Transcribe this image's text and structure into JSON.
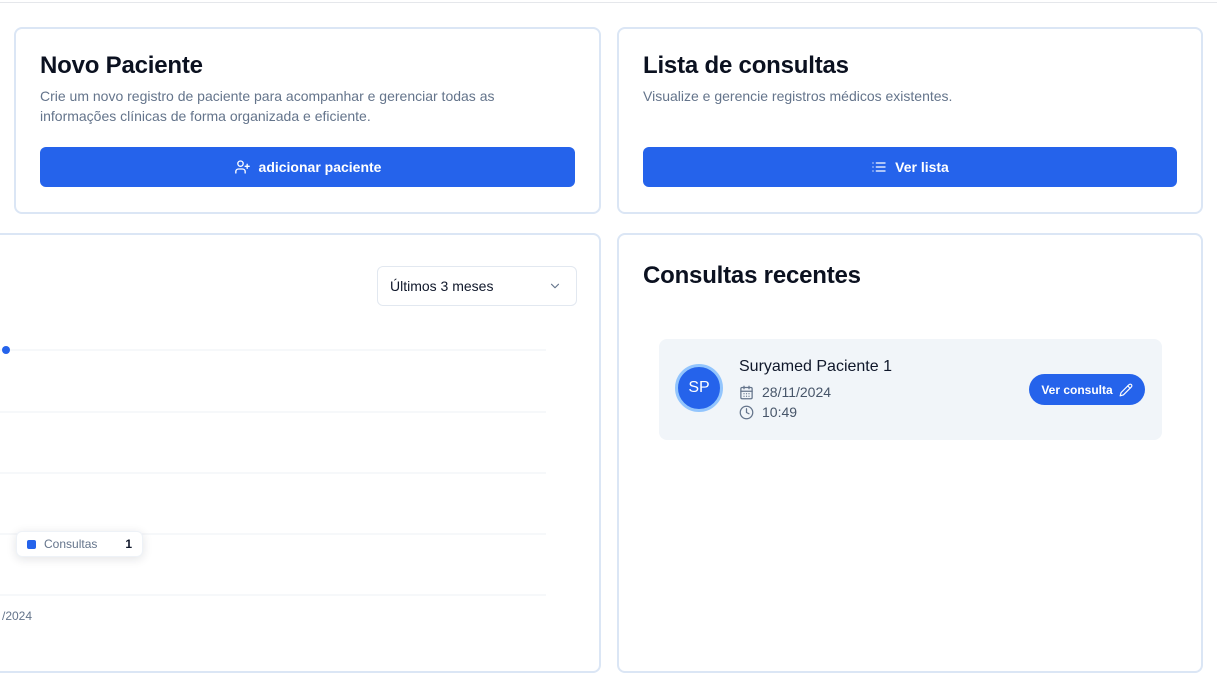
{
  "new_patient": {
    "title": "Novo Paciente",
    "description": "Crie um novo registro de paciente para acompanhar e gerenciar todas as informações clínicas de forma organizada e eficiente.",
    "button_label": "adicionar paciente",
    "button_icon": "user-plus-icon"
  },
  "consult_list": {
    "title": "Lista de consultas",
    "description": "Visualize e gerencie registros médicos existentes.",
    "button_label": "Ver lista",
    "button_icon": "list-icon"
  },
  "chart": {
    "range_select": {
      "selected": "Últimos 3 meses"
    },
    "x_tick_partial": "/2024",
    "tooltip": {
      "series": "Consultas",
      "value": "1"
    }
  },
  "chart_data": {
    "type": "line",
    "series": [
      {
        "name": "Consultas",
        "values": [
          1
        ]
      }
    ],
    "x_tick_labels": [
      "/2024"
    ],
    "grid": true
  },
  "recent": {
    "title": "Consultas recentes",
    "items": [
      {
        "initials": "SP",
        "name": "Suryamed Paciente 1",
        "date": "28/11/2024",
        "time": "10:49",
        "button_label": "Ver consulta"
      }
    ]
  },
  "colors": {
    "primary": "#2563eb",
    "card_border": "#dbe6f5",
    "item_bg": "#f1f5f9",
    "muted_text": "#64748b"
  }
}
